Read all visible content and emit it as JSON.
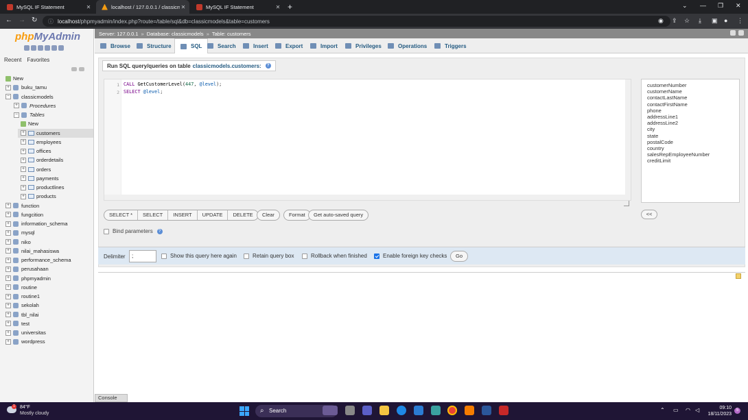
{
  "browser": {
    "tabs": [
      {
        "title": "MySQL IF Statement",
        "active": false
      },
      {
        "title": "localhost / 127.0.0.1 / classicmo",
        "active": true
      },
      {
        "title": "MySQL IF Statement",
        "active": false
      }
    ],
    "url_host": "localhost",
    "url_path": "/phpmyadmin/index.php?route=/table/sql&db=classicmodels&table=customers"
  },
  "nav": {
    "logo_php": "php",
    "logo_myadmin": "MyAdmin",
    "tab_recent": "Recent",
    "tab_favorites": "Favorites",
    "tree": [
      {
        "label": "New",
        "kind": "new",
        "depth": 0
      },
      {
        "label": "buku_tamu",
        "kind": "db",
        "depth": 0
      },
      {
        "label": "classicmodels",
        "kind": "db",
        "depth": 0,
        "expanded": true
      },
      {
        "label": "Procedures",
        "kind": "group",
        "depth": 1
      },
      {
        "label": "Tables",
        "kind": "group",
        "depth": 1,
        "expanded": true
      },
      {
        "label": "New",
        "kind": "new",
        "depth": 2
      },
      {
        "label": "customers",
        "kind": "table",
        "depth": 2,
        "selected": true
      },
      {
        "label": "employees",
        "kind": "table",
        "depth": 2
      },
      {
        "label": "offices",
        "kind": "table",
        "depth": 2
      },
      {
        "label": "orderdetails",
        "kind": "table",
        "depth": 2
      },
      {
        "label": "orders",
        "kind": "table",
        "depth": 2
      },
      {
        "label": "payments",
        "kind": "table",
        "depth": 2
      },
      {
        "label": "productlines",
        "kind": "table",
        "depth": 2
      },
      {
        "label": "products",
        "kind": "table",
        "depth": 2
      },
      {
        "label": "function",
        "kind": "db",
        "depth": 0
      },
      {
        "label": "fungcition",
        "kind": "db",
        "depth": 0
      },
      {
        "label": "information_schema",
        "kind": "db",
        "depth": 0
      },
      {
        "label": "mysql",
        "kind": "db",
        "depth": 0
      },
      {
        "label": "niko",
        "kind": "db",
        "depth": 0
      },
      {
        "label": "nilai_mahasiswa",
        "kind": "db",
        "depth": 0
      },
      {
        "label": "performance_schema",
        "kind": "db",
        "depth": 0
      },
      {
        "label": "perusahaan",
        "kind": "db",
        "depth": 0
      },
      {
        "label": "phpmyadmin",
        "kind": "db",
        "depth": 0
      },
      {
        "label": "routine",
        "kind": "db",
        "depth": 0
      },
      {
        "label": "routine1",
        "kind": "db",
        "depth": 0
      },
      {
        "label": "sekolah",
        "kind": "db",
        "depth": 0
      },
      {
        "label": "tbl_nilai",
        "kind": "db",
        "depth": 0
      },
      {
        "label": "test",
        "kind": "db",
        "depth": 0
      },
      {
        "label": "universitas",
        "kind": "db",
        "depth": 0
      },
      {
        "label": "wordpress",
        "kind": "db",
        "depth": 0
      }
    ]
  },
  "breadcrumb": {
    "server": "Server: 127.0.0.1",
    "database": "Database: classicmodels",
    "table": "Table: customers",
    "separator": "»"
  },
  "menu": [
    "Browse",
    "Structure",
    "SQL",
    "Search",
    "Insert",
    "Export",
    "Import",
    "Privileges",
    "Operations",
    "Triggers"
  ],
  "menu_active": "SQL",
  "sql": {
    "title_prefix": "Run SQL query/queries on table",
    "title_table": "classicmodels.customers:",
    "line1_no": "1",
    "line2_no": "2",
    "line1_kw": "CALL",
    "line1_fn": " GetCustomerLevel(",
    "line1_num": "447",
    "line1_sep": ", ",
    "line1_var": "@level",
    "line1_end": ");",
    "line2_kw": "SELECT",
    "line2_var": " @level",
    "line2_end": ";",
    "columns": [
      "customerNumber",
      "customerName",
      "contactLastName",
      "contactFirstName",
      "phone",
      "addressLine1",
      "addressLine2",
      "city",
      "state",
      "postalCode",
      "country",
      "salesRepEmployeeNumber",
      "creditLimit"
    ],
    "insert_btn": "<<",
    "query_buttons": [
      "SELECT *",
      "SELECT",
      "INSERT",
      "UPDATE",
      "DELETE"
    ],
    "clear": "Clear",
    "format": "Format",
    "autosaved": "Get auto-saved query",
    "bind_params": "Bind parameters"
  },
  "options": {
    "delimiter_label": "Delimiter",
    "delimiter_value": ";",
    "show_again": "Show this query here again",
    "retain": "Retain query box",
    "rollback": "Rollback when finished",
    "foreign_keys": "Enable foreign key checks",
    "foreign_keys_checked": true,
    "go": "Go"
  },
  "console": "Console",
  "taskbar": {
    "temp": "84°F",
    "weather": "Mostly cloudy",
    "weather_badge": "1",
    "search": "Search",
    "time": "09:10",
    "date": "18/11/2023",
    "notifications": "5"
  }
}
